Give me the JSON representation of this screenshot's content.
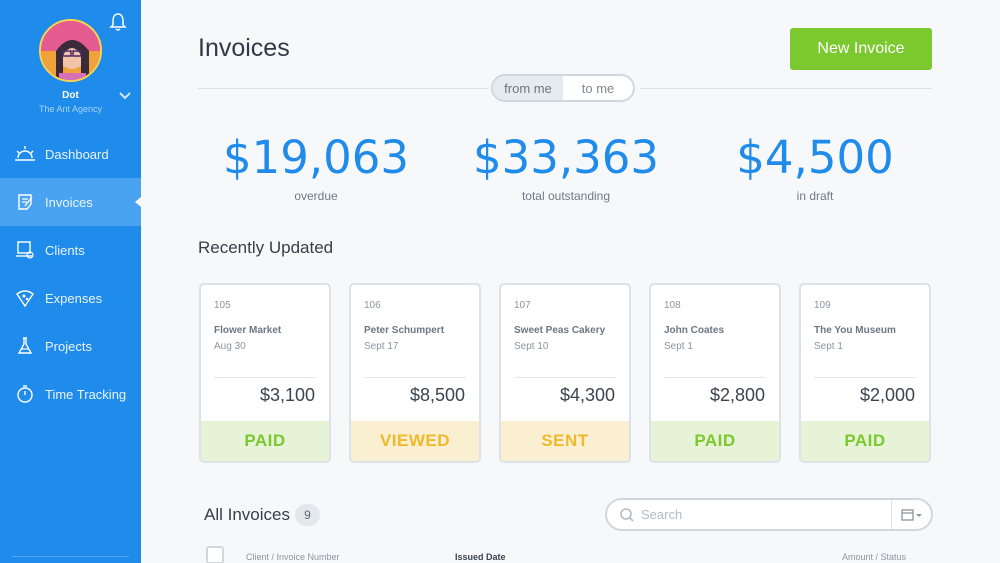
{
  "user": {
    "name": "Dot",
    "org": "The Ant Agency"
  },
  "nav": [
    {
      "label": "Dashboard",
      "icon": "dashboard-sun-icon"
    },
    {
      "label": "Invoices",
      "icon": "invoice-icon",
      "active": true
    },
    {
      "label": "Clients",
      "icon": "clients-icon"
    },
    {
      "label": "Expenses",
      "icon": "expenses-icon"
    },
    {
      "label": "Projects",
      "icon": "projects-flask-icon"
    },
    {
      "label": "Time Tracking",
      "icon": "stopwatch-icon"
    }
  ],
  "header": {
    "title": "Invoices",
    "new_button": "New Invoice"
  },
  "toggle": {
    "from": "from me",
    "to": "to me",
    "selected": "from me"
  },
  "stats": [
    {
      "amount": "$19,063",
      "label": "overdue"
    },
    {
      "amount": "$33,363",
      "label": "total outstanding"
    },
    {
      "amount": "$4,500",
      "label": "in draft"
    }
  ],
  "recent": {
    "title": "Recently Updated",
    "cards": [
      {
        "number": "105",
        "client": "Flower Market",
        "date": "Aug 30",
        "amount": "$3,100",
        "status": "PAID"
      },
      {
        "number": "106",
        "client": "Peter Schumpert",
        "date": "Sept 17",
        "amount": "$8,500",
        "status": "VIEWED"
      },
      {
        "number": "107",
        "client": "Sweet Peas Cakery",
        "date": "Sept 10",
        "amount": "$4,300",
        "status": "SENT"
      },
      {
        "number": "108",
        "client": "John Coates",
        "date": "Sept 1",
        "amount": "$2,800",
        "status": "PAID"
      },
      {
        "number": "109",
        "client": "The You Museum",
        "date": "Sept 1",
        "amount": "$2,000",
        "status": "PAID"
      }
    ]
  },
  "all": {
    "title": "All Invoices",
    "count": "9",
    "search_placeholder": "Search",
    "columns": {
      "client": "Client / Invoice Number",
      "issued": "Issued Date",
      "amount": "Amount / Status"
    }
  },
  "colors": {
    "sidebar": "#1f8bea",
    "accent_green": "#7bc82f",
    "status_yellow": "#f0b92b",
    "stat_blue": "#1f8bea"
  }
}
